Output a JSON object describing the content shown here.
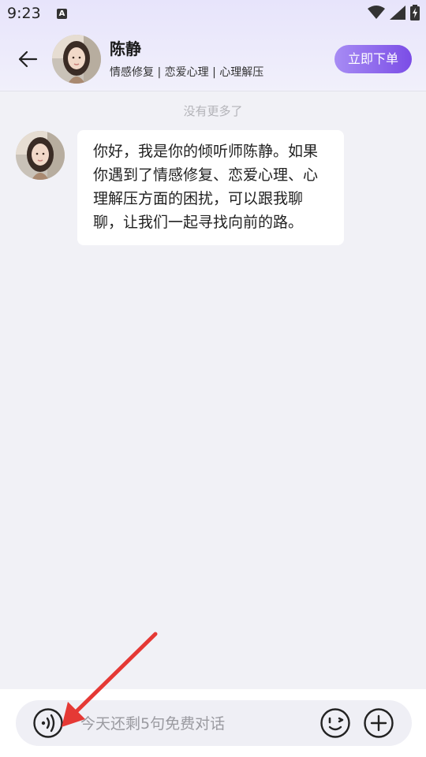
{
  "status_bar": {
    "time": "9:23",
    "notif_letter": "A"
  },
  "header": {
    "name": "陈静",
    "tags": "情感修复 | 恋爱心理 | 心理解压",
    "order_button": "立即下单"
  },
  "chat": {
    "no_more": "没有更多了",
    "messages": [
      {
        "text": "你好，我是你的倾听师陈静。如果你遇到了情感修复、恋爱心理、心理解压方面的困扰，可以跟我聊聊，让我们一起寻找向前的路。"
      }
    ]
  },
  "input": {
    "placeholder": "今天还剩5句免费对话"
  },
  "colors": {
    "accent": "#7b4de6",
    "annotation_arrow": "#e53935"
  }
}
